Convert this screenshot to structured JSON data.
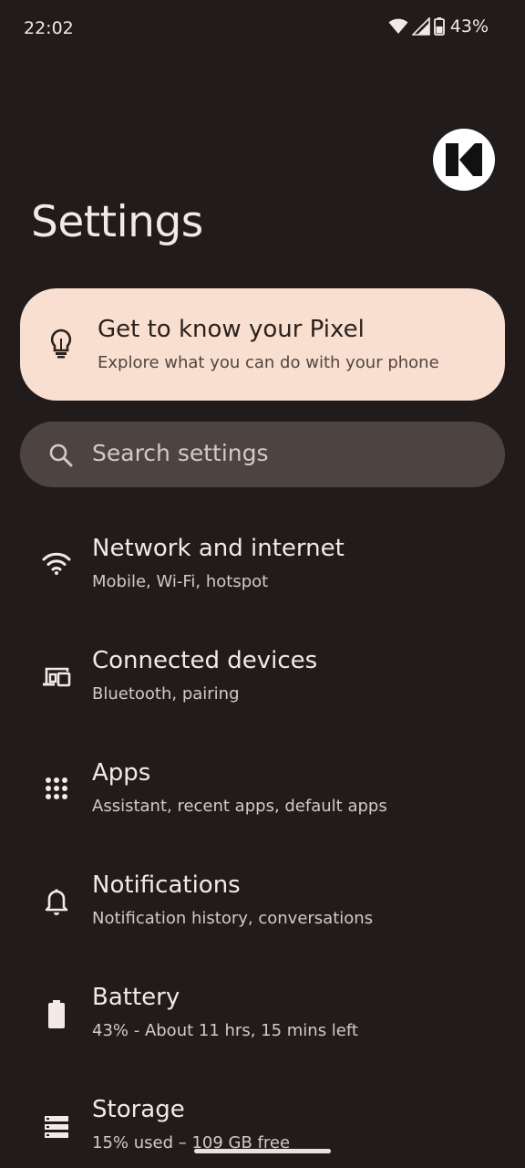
{
  "status_bar": {
    "time": "22:02",
    "battery_percent": "43%",
    "icons": [
      "wifi-icon",
      "cellular-signal-icon",
      "battery-icon"
    ]
  },
  "header": {
    "title": "Settings",
    "avatar_icon": "account-avatar-icon"
  },
  "tips_card": {
    "icon": "lightbulb-icon",
    "title": "Get to know your Pixel",
    "subtitle": "Explore what you can do with your phone"
  },
  "search": {
    "icon": "search-icon",
    "placeholder": "Search settings"
  },
  "settings": {
    "items": [
      {
        "icon": "wifi-icon",
        "title": "Network and internet",
        "subtitle": "Mobile, Wi-Fi, hotspot"
      },
      {
        "icon": "devices-icon",
        "title": "Connected devices",
        "subtitle": "Bluetooth, pairing"
      },
      {
        "icon": "apps-grid-icon",
        "title": "Apps",
        "subtitle": "Assistant, recent apps, default apps"
      },
      {
        "icon": "bell-icon",
        "title": "Notifications",
        "subtitle": "Notification history, conversations"
      },
      {
        "icon": "battery-icon",
        "title": "Battery",
        "subtitle": "43% - About 11 hrs, 15 mins left"
      },
      {
        "icon": "storage-icon",
        "title": "Storage",
        "subtitle": "15% used – 109 GB free"
      }
    ]
  },
  "colors": {
    "background": "#211c1b",
    "tips_card": "#f8dfd0",
    "search_bar": "#4d4442",
    "text_primary": "#f3e9e6",
    "text_secondary": "#d6c8c3"
  }
}
